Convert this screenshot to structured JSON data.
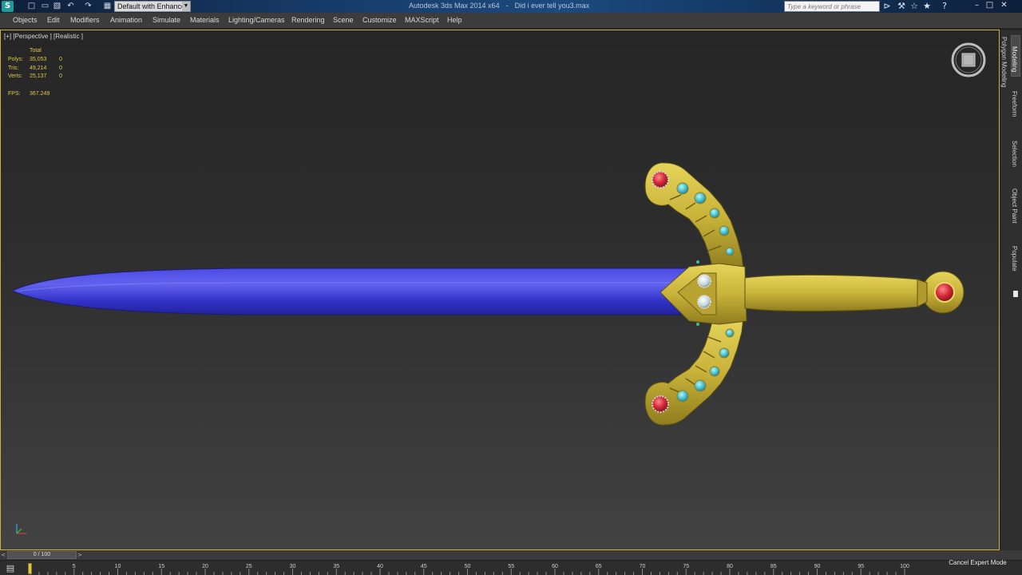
{
  "titlebar": {
    "app_logo": "S",
    "quick_access": [
      "new-file-icon",
      "open-file-icon",
      "save-file-icon",
      "undo-icon",
      "redo-icon",
      "project-folder-icon"
    ],
    "workspace": "Default with Enhance",
    "app_name": "Autodesk 3ds Max  2014 x64",
    "file_name": "Did i ever tell you3.max",
    "search_placeholder": "Type a keyword or phrase",
    "toolbar_icons": [
      "binoculars-icon",
      "tools-icon",
      "star-icon",
      "help-icon"
    ],
    "window_controls": [
      "minimize-icon",
      "restore-icon",
      "close-icon"
    ]
  },
  "menu": {
    "items": [
      "Objects",
      "Edit",
      "Modifiers",
      "Animation",
      "Simulate",
      "Materials",
      "Lighting/Cameras",
      "Rendering",
      "Scene",
      "Customize",
      "MAXScript",
      "Help"
    ]
  },
  "viewport": {
    "label": "[+] [Perspective ] [Realistic ]",
    "stats": {
      "header": "Total",
      "rows": [
        {
          "key": "Polys:",
          "total": "35,053",
          "sel": "0"
        },
        {
          "key": "Tris:",
          "total": "49,214",
          "sel": "0"
        },
        {
          "key": "Verts:",
          "total": "25,137",
          "sel": "0"
        }
      ],
      "fps_key": "FPS:",
      "fps_value": "367.249"
    }
  },
  "ribbon": {
    "tabs": [
      "Modeling",
      "Freeform",
      "Selection",
      "Object Paint",
      "Populate"
    ],
    "panel": "Polygon Modeling"
  },
  "timeslider": {
    "label": "0 / 100",
    "prev": "<",
    "next": ">"
  },
  "trackbar": {
    "ticks": [
      "5",
      "10",
      "15",
      "20",
      "25",
      "30",
      "35",
      "40",
      "45",
      "50",
      "55",
      "60",
      "65",
      "70",
      "75",
      "80",
      "85",
      "90",
      "95",
      "100"
    ],
    "icon": "key-filter-icon"
  },
  "status": {
    "expert_mode_button": "Cancel Expert Mode"
  },
  "colors": {
    "blade": "#3a3ad6",
    "gold": "#c9b33a",
    "gem_red": "#d42a3a",
    "gem_cyan": "#4ec6d6",
    "viewport_border": "#cfb23a"
  }
}
